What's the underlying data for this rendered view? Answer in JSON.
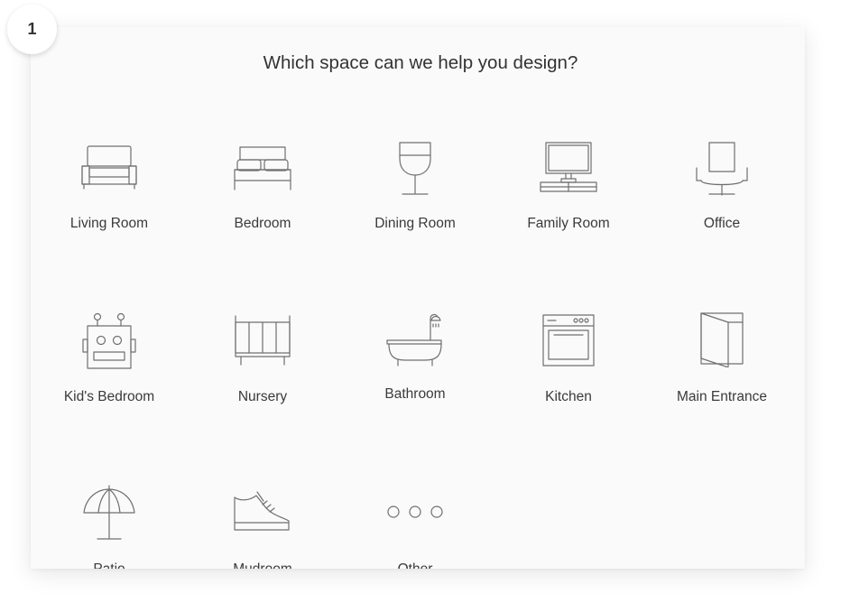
{
  "step": {
    "number": "1"
  },
  "page": {
    "title": "Which space can we help you design?"
  },
  "spaces": [
    {
      "label": "Living Room",
      "icon": "sofa-icon"
    },
    {
      "label": "Bedroom",
      "icon": "bed-icon"
    },
    {
      "label": "Dining Room",
      "icon": "wine-glass-icon"
    },
    {
      "label": "Family Room",
      "icon": "tv-icon"
    },
    {
      "label": "Office",
      "icon": "office-chair-icon"
    },
    {
      "label": "Kid's Bedroom",
      "icon": "robot-icon"
    },
    {
      "label": "Nursery",
      "icon": "crib-icon"
    },
    {
      "label": "Bathroom",
      "icon": "bathtub-icon"
    },
    {
      "label": "Kitchen",
      "icon": "oven-icon"
    },
    {
      "label": "Main Entrance",
      "icon": "door-icon"
    },
    {
      "label": "Patio",
      "icon": "umbrella-icon"
    },
    {
      "label": "Mudroom",
      "icon": "shoe-icon"
    },
    {
      "label": "Other",
      "icon": "more-dots-icon"
    }
  ]
}
